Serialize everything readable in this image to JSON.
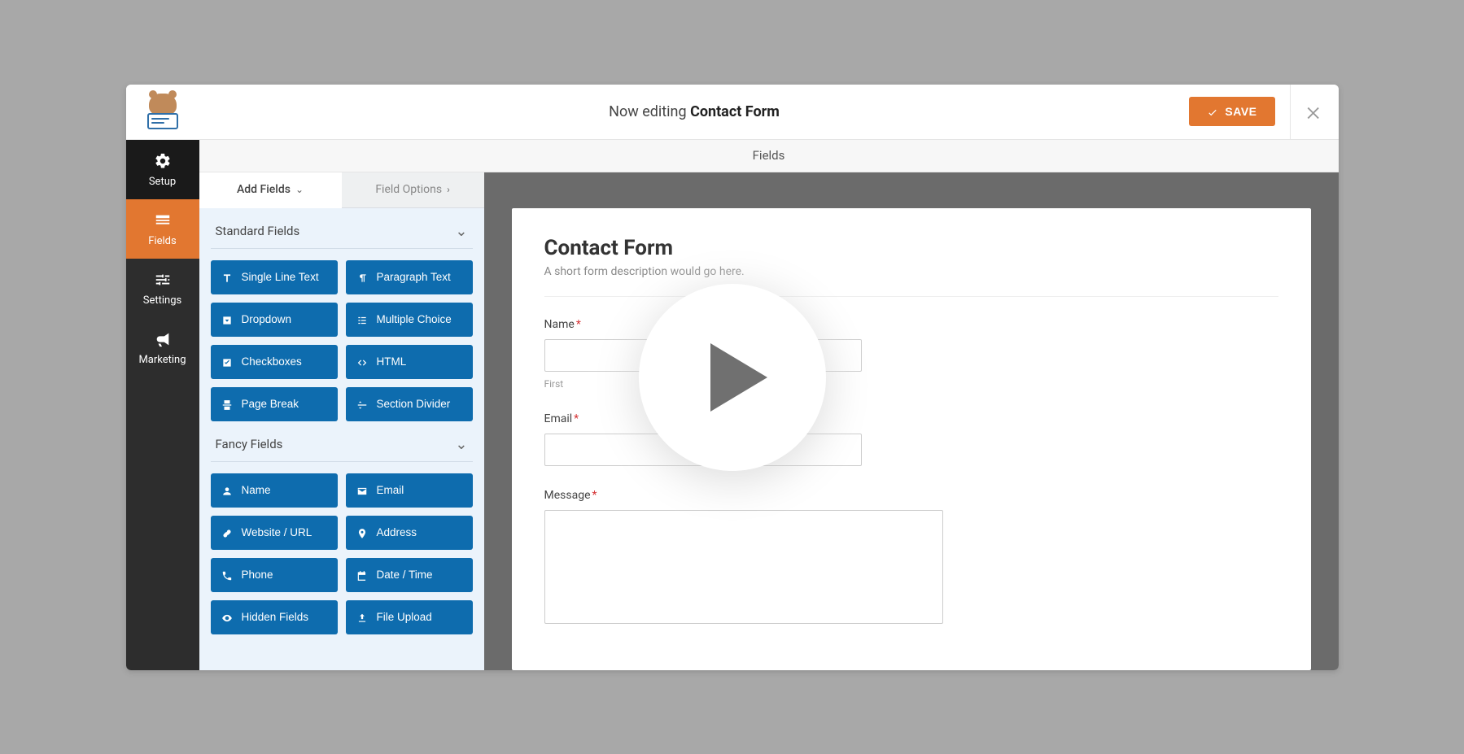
{
  "topbar": {
    "prefix": "Now editing ",
    "title": "Contact Form",
    "save_label": "SAVE"
  },
  "nav": {
    "setup": "Setup",
    "fields": "Fields",
    "settings": "Settings",
    "marketing": "Marketing"
  },
  "fields_header": "Fields",
  "panel_tabs": {
    "add_fields": "Add Fields",
    "field_options": "Field Options"
  },
  "sections": {
    "standard_title": "Standard Fields",
    "fancy_title": "Fancy Fields"
  },
  "standard_fields": [
    {
      "icon": "text-icon",
      "label": "Single Line Text"
    },
    {
      "icon": "paragraph-icon",
      "label": "Paragraph Text"
    },
    {
      "icon": "dropdown-icon",
      "label": "Dropdown"
    },
    {
      "icon": "multiple-choice-icon",
      "label": "Multiple Choice"
    },
    {
      "icon": "checkbox-icon",
      "label": "Checkboxes"
    },
    {
      "icon": "html-icon",
      "label": "HTML"
    },
    {
      "icon": "pagebreak-icon",
      "label": "Page Break"
    },
    {
      "icon": "divider-icon",
      "label": "Section Divider"
    }
  ],
  "fancy_fields": [
    {
      "icon": "user-icon",
      "label": "Name"
    },
    {
      "icon": "email-icon",
      "label": "Email"
    },
    {
      "icon": "link-icon",
      "label": "Website / URL"
    },
    {
      "icon": "pin-icon",
      "label": "Address"
    },
    {
      "icon": "phone-icon",
      "label": "Phone"
    },
    {
      "icon": "calendar-icon",
      "label": "Date / Time"
    },
    {
      "icon": "eye-icon",
      "label": "Hidden Fields"
    },
    {
      "icon": "upload-icon",
      "label": "File Upload"
    }
  ],
  "form": {
    "title": "Contact Form",
    "description": "A short form description would go here.",
    "name_label": "Name",
    "name_sublabel": "First",
    "email_label": "Email",
    "message_label": "Message",
    "required_marker": "*"
  }
}
